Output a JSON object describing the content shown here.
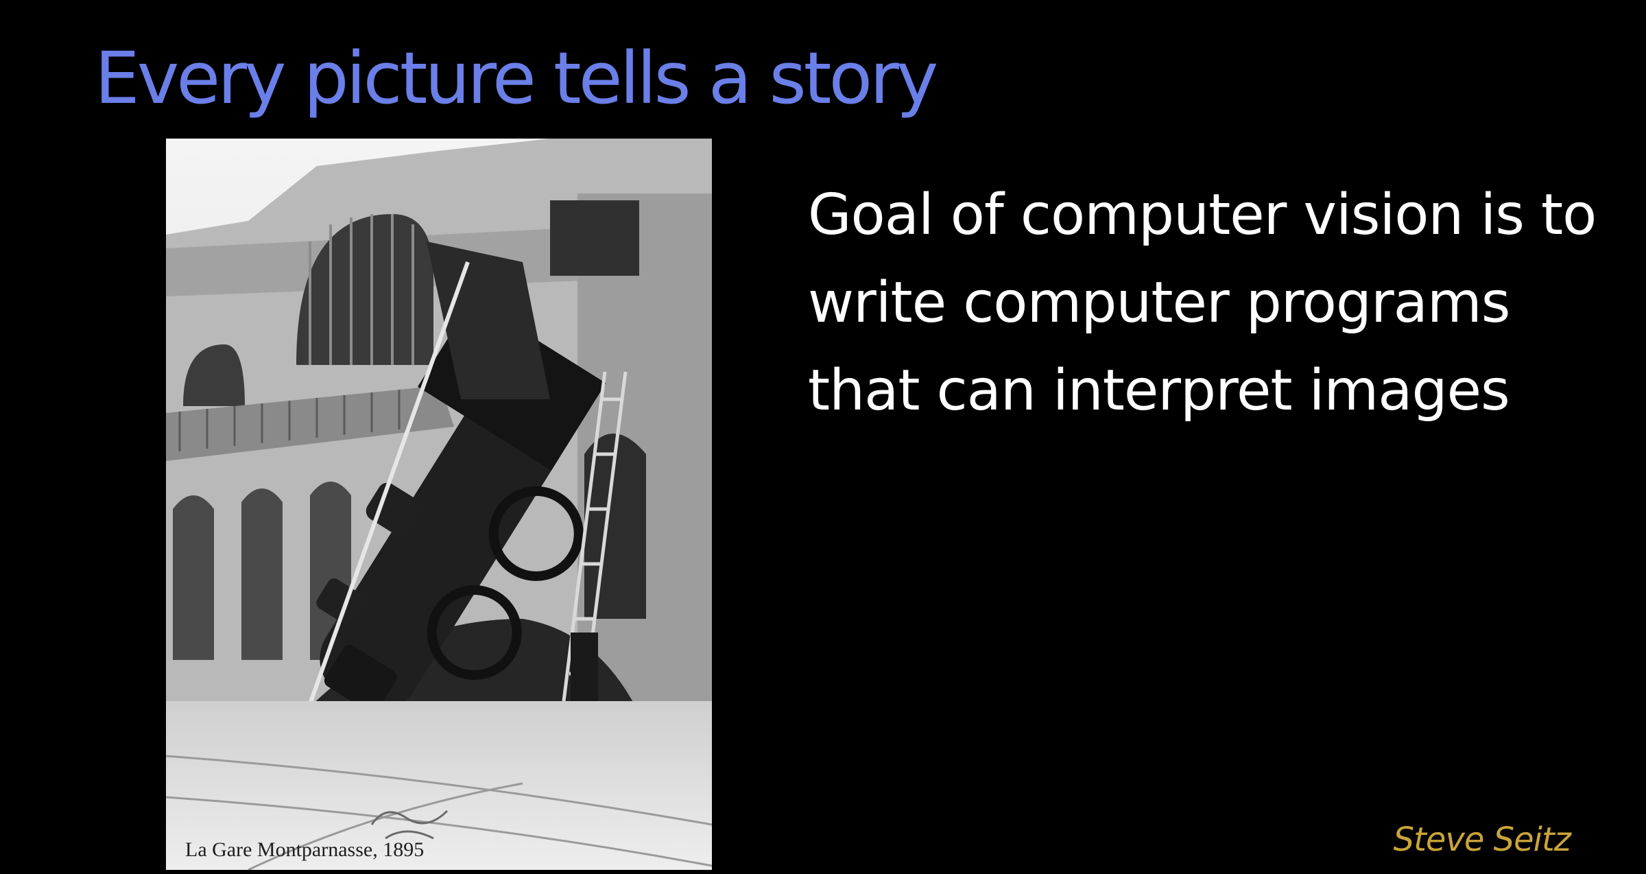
{
  "slide": {
    "title": "Every picture tells a story",
    "body": "Goal of computer vision is to write computer programs that can interpret images",
    "attribution": "Steve Seitz",
    "photo_caption": "La Gare Montparnasse, 1895"
  },
  "colors": {
    "background": "#000000",
    "title": "#6b7fe8",
    "body": "#ffffff",
    "attribution": "#c9a43a"
  }
}
